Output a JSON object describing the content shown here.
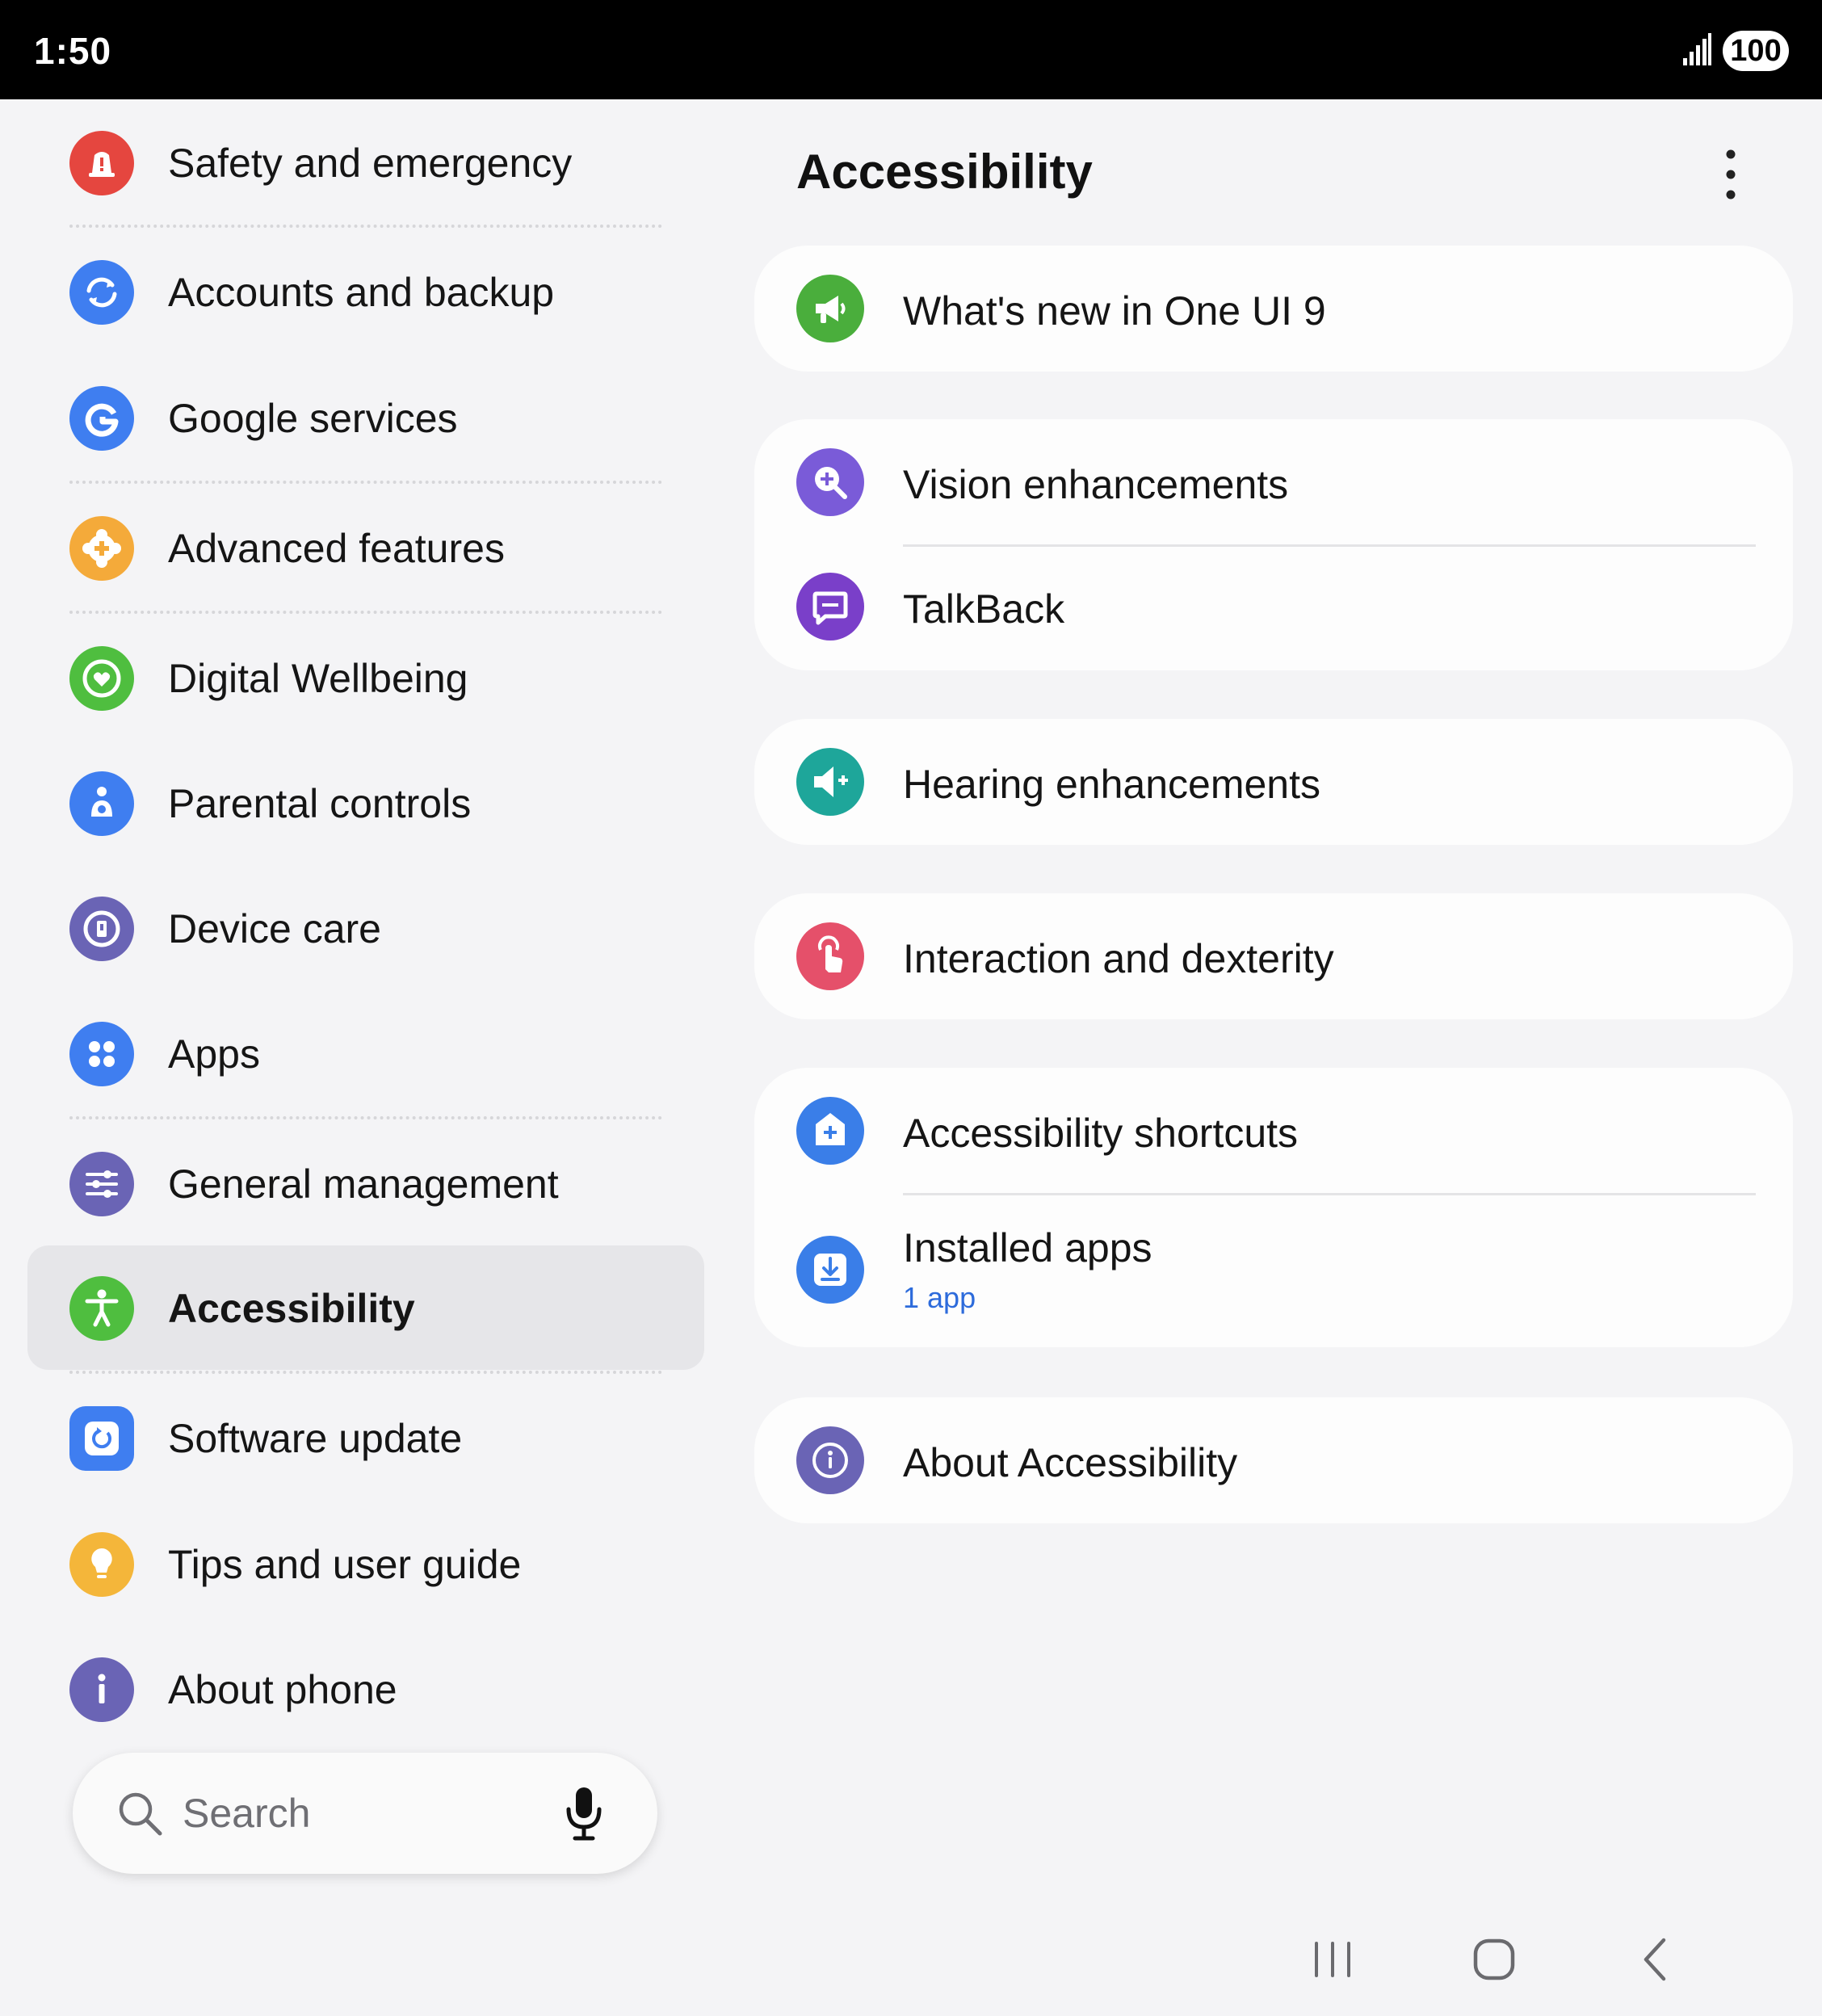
{
  "status_bar": {
    "time": "1:50",
    "battery": "100"
  },
  "sidebar": {
    "items": [
      {
        "label": "Safety and emergency",
        "icon": "safety-icon",
        "color": "#e5463f"
      },
      {
        "label": "Accounts and backup",
        "icon": "sync-icon",
        "color": "#3f7ef0"
      },
      {
        "label": "Google services",
        "icon": "google-icon",
        "color": "#3f7ef0"
      },
      {
        "label": "Advanced features",
        "icon": "advanced-features-icon",
        "color": "#f4aa3a"
      },
      {
        "label": "Digital Wellbeing",
        "icon": "wellbeing-icon",
        "color": "#4fbe3f"
      },
      {
        "label": "Parental controls",
        "icon": "parental-icon",
        "color": "#3f7ef0"
      },
      {
        "label": "Device care",
        "icon": "device-care-icon",
        "color": "#6a64b5"
      },
      {
        "label": "Apps",
        "icon": "apps-icon",
        "color": "#3f7ef0"
      },
      {
        "label": "General management",
        "icon": "sliders-icon",
        "color": "#6a64b5"
      },
      {
        "label": "Accessibility",
        "icon": "accessibility-icon",
        "color": "#4fbe3f",
        "selected": true
      },
      {
        "label": "Software update",
        "icon": "software-update-icon",
        "color": "#3f7ef0"
      },
      {
        "label": "Tips and user guide",
        "icon": "lightbulb-icon",
        "color": "#f4b63a"
      },
      {
        "label": "About phone",
        "icon": "info-icon",
        "color": "#6a64b5"
      }
    ]
  },
  "search": {
    "placeholder": "Search"
  },
  "main": {
    "title": "Accessibility",
    "more_icon": "more-vert-icon",
    "cards": [
      {
        "rows": [
          {
            "label": "What's new in One UI 9",
            "icon": "megaphone-icon",
            "color": "#4aae3c"
          }
        ]
      },
      {
        "rows": [
          {
            "label": "Vision enhancements",
            "icon": "magnifier-plus-icon",
            "color": "#7a5bd8"
          },
          {
            "label": "TalkBack",
            "icon": "talkback-icon",
            "color": "#7a3fc9"
          }
        ]
      },
      {
        "rows": [
          {
            "label": "Hearing enhancements",
            "icon": "speaker-plus-icon",
            "color": "#1ea69a"
          }
        ]
      },
      {
        "rows": [
          {
            "label": "Interaction and dexterity",
            "icon": "touch-icon",
            "color": "#e5506a"
          }
        ]
      },
      {
        "rows": [
          {
            "label": "Accessibility shortcuts",
            "icon": "shortcut-icon",
            "color": "#3a7ee8"
          },
          {
            "label": "Installed apps",
            "sublabel": "1 app",
            "icon": "download-icon",
            "color": "#3a7ee8"
          }
        ]
      },
      {
        "rows": [
          {
            "label": "About Accessibility",
            "icon": "info-icon",
            "color": "#6a64b5"
          }
        ]
      }
    ]
  },
  "navbar": {
    "buttons": [
      "recents-icon",
      "home-icon",
      "back-icon"
    ]
  }
}
